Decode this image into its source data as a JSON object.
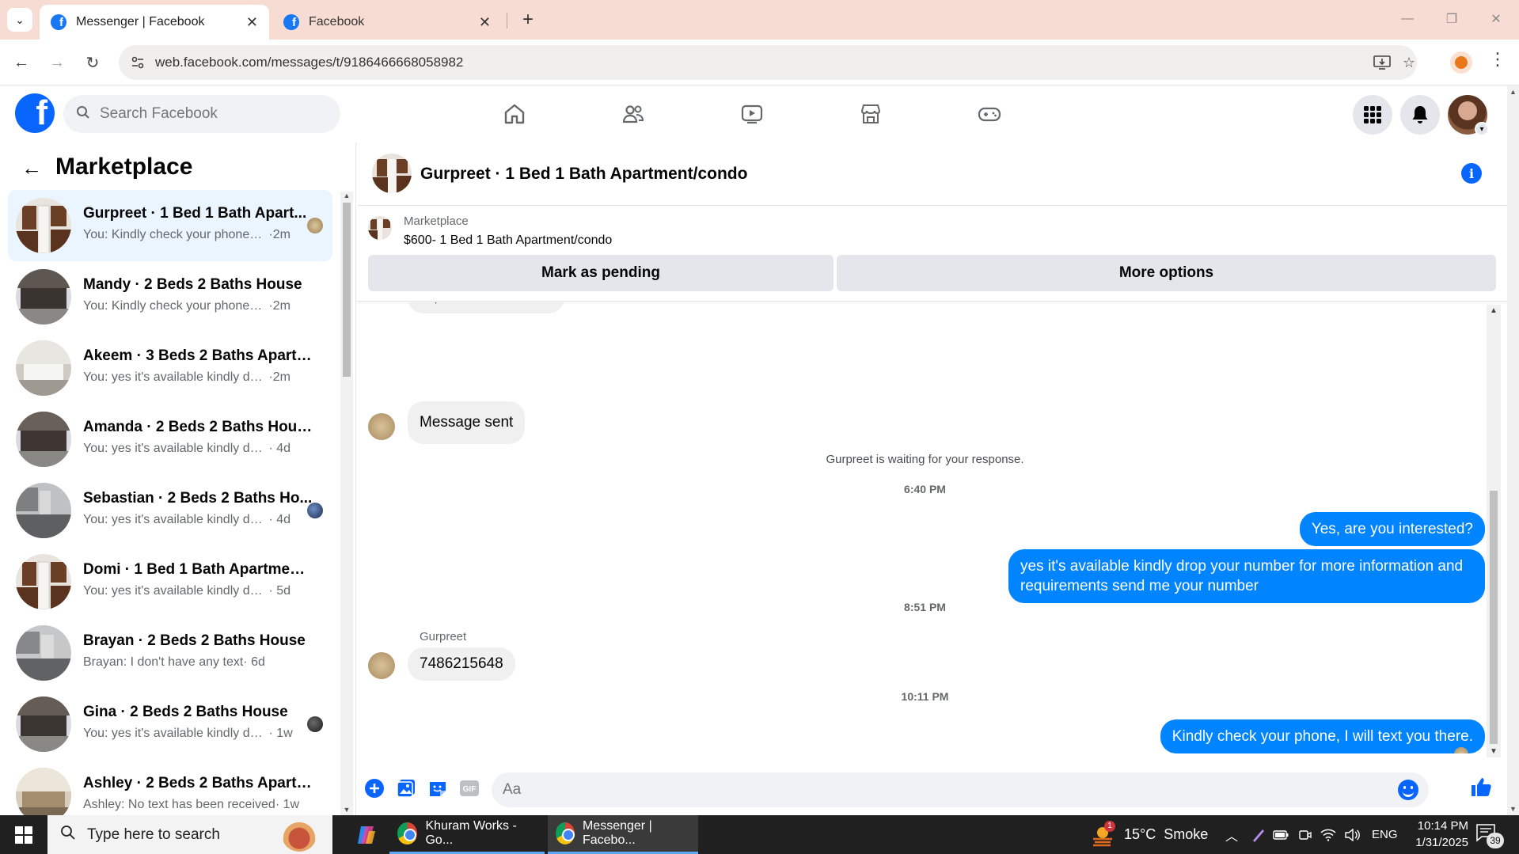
{
  "browser": {
    "tabs": [
      {
        "title": "Messenger | Facebook",
        "active": true
      },
      {
        "title": "Facebook",
        "active": false
      }
    ],
    "url": "web.facebook.com/messages/t/9186466668058982"
  },
  "fb": {
    "search_placeholder": "Search Facebook",
    "brand_color": "#0866ff"
  },
  "sidebar": {
    "title": "Marketplace",
    "conversations": [
      {
        "name": "Gurpreet · 1 Bed 1 Bath Apart...",
        "preview": "You: Kindly check your phone, I...",
        "time": "·2m",
        "active": true,
        "thumb": "kitchen"
      },
      {
        "name": "Mandy · 2 Beds 2 Baths House",
        "preview": "You: Kindly check your phone, I wi...",
        "time": "·2m",
        "thumb": "house"
      },
      {
        "name": "Akeem · 3 Beds 2 Baths Apartm...",
        "preview": "You: yes it's available kindly drop y...",
        "time": "·2m",
        "thumb": "interior"
      },
      {
        "name": "Amanda · 2 Beds 2 Baths House",
        "preview": "You: yes it's available kindly drop y...",
        "time": "· 4d",
        "thumb": "house"
      },
      {
        "name": "Sebastian · 2 Beds 2 Baths Ho...",
        "preview": "You: yes it's available kindly dro...",
        "time": "· 4d",
        "thumb": "kitchen2"
      },
      {
        "name": "Domi · 1 Bed 1 Bath Apartment/...",
        "preview": "You: yes it's available kindly drop y...",
        "time": "· 5d",
        "thumb": "kitchen"
      },
      {
        "name": "Brayan · 2 Beds 2 Baths House",
        "preview": "Brayan: I don't have any text",
        "time": "· 6d",
        "thumb": "kitchen2"
      },
      {
        "name": "Gina · 2 Beds 2 Baths House",
        "preview": "You: yes it's available kindly dro...",
        "time": "· 1w",
        "thumb": "house"
      },
      {
        "name": "Ashley · 2 Beds 2 Baths Apartm...",
        "preview": "Ashley: No text has been received",
        "time": "· 1w",
        "thumb": "interior"
      }
    ]
  },
  "chat": {
    "title": "Gurpreet · 1 Bed 1 Bath Apartment/condo",
    "listing_label": "Marketplace",
    "listing_title": "$600- 1 Bed 1 Bath Apartment/condo",
    "btn_pending": "Mark as pending",
    "btn_more": "More options",
    "clipped_message": "Hi, is this available?",
    "msg_sent": "Message sent",
    "waiting": "Gurpreet is waiting for your response.",
    "time1": "6:40 PM",
    "out1": "Yes, are you interested?",
    "out2": "yes it's available kindly drop your number for more information and requirements send me your number",
    "time2": "8:51 PM",
    "sender": "Gurpreet",
    "in_phone": "7486215648",
    "time3": "10:11 PM",
    "out3": "Kindly check your phone, I will text you there.",
    "composer_placeholder": "Aa",
    "gif_label": "GIF"
  },
  "taskbar": {
    "search_placeholder": "Type here to search",
    "apps": [
      {
        "label": "Khuram Works - Go..."
      },
      {
        "label": "Messenger | Facebo..."
      }
    ],
    "weather": "15°C  Smoke",
    "weather_badge": "1",
    "lang": "ENG",
    "time": "10:14 PM",
    "date": "1/31/2025",
    "notif_count": "39"
  }
}
